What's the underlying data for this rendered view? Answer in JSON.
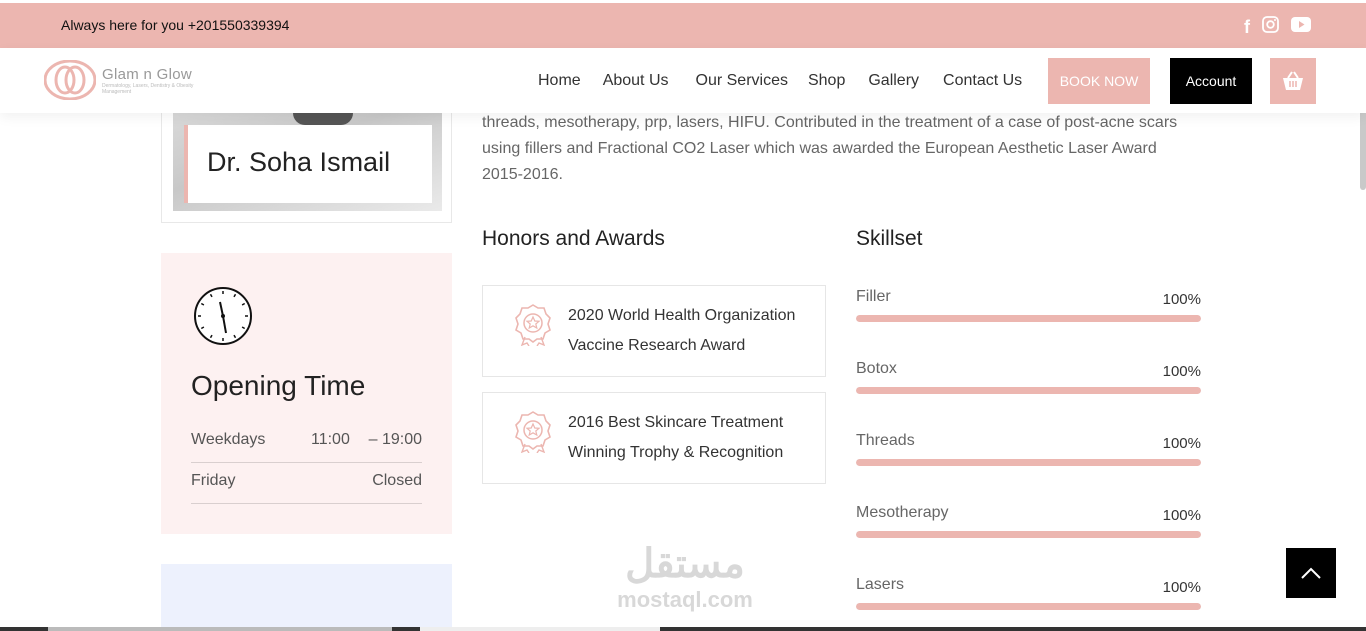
{
  "topbar": {
    "phone": "Always here for you +201550339394",
    "social": [
      {
        "icon": "facebook-icon",
        "glyph": "f"
      },
      {
        "icon": "instagram-icon",
        "glyph": "◎"
      },
      {
        "icon": "youtube-icon",
        "glyph": "▶"
      }
    ]
  },
  "logo": {
    "brand": "Glam n Glow",
    "tagline": "Dermatology, Lasers, Dentistry & Obesity Management"
  },
  "nav": {
    "items": [
      "Home",
      "About Us",
      "Our Services",
      "Shop",
      "Gallery",
      "Contact Us"
    ],
    "book_label": "BOOK NOW",
    "account_label": "Account"
  },
  "doctor": {
    "name": "Dr. Soha Ismail"
  },
  "opening": {
    "title": "Opening Time",
    "rows": [
      {
        "day": "Weekdays",
        "open": "11:00",
        "close": "– 19:00"
      },
      {
        "day": "Friday",
        "open": "",
        "close": "Closed"
      }
    ]
  },
  "intro": {
    "text": "threads, mesotherapy, prp, lasers, HIFU. Contributed in the treatment of a case of post-acne scars using fillers and Fractional CO2 Laser which was awarded the European Aesthetic Laser Award 2015-2016."
  },
  "honors": {
    "title": "Honors and Awards",
    "items": [
      {
        "text": "2020 World Health Organization Vaccine Research Award"
      },
      {
        "text": "2016 Best Skincare Treatment Winning Trophy & Recognition"
      }
    ]
  },
  "skills": {
    "title": "Skillset",
    "items": [
      {
        "name": "Filler",
        "percent_label": "100%",
        "percent": 100
      },
      {
        "name": "Botox",
        "percent_label": "100%",
        "percent": 100
      },
      {
        "name": "Threads",
        "percent_label": "100%",
        "percent": 100
      },
      {
        "name": "Mesotherapy",
        "percent_label": "100%",
        "percent": 100
      },
      {
        "name": "Lasers",
        "percent_label": "100%",
        "percent": 100
      }
    ]
  },
  "watermark": {
    "arabic": "مستقل",
    "latin": "mostaql.com"
  },
  "colors": {
    "accent": "#ecb6b0",
    "dark": "#000000",
    "opening_bg": "#fdf1f1"
  }
}
